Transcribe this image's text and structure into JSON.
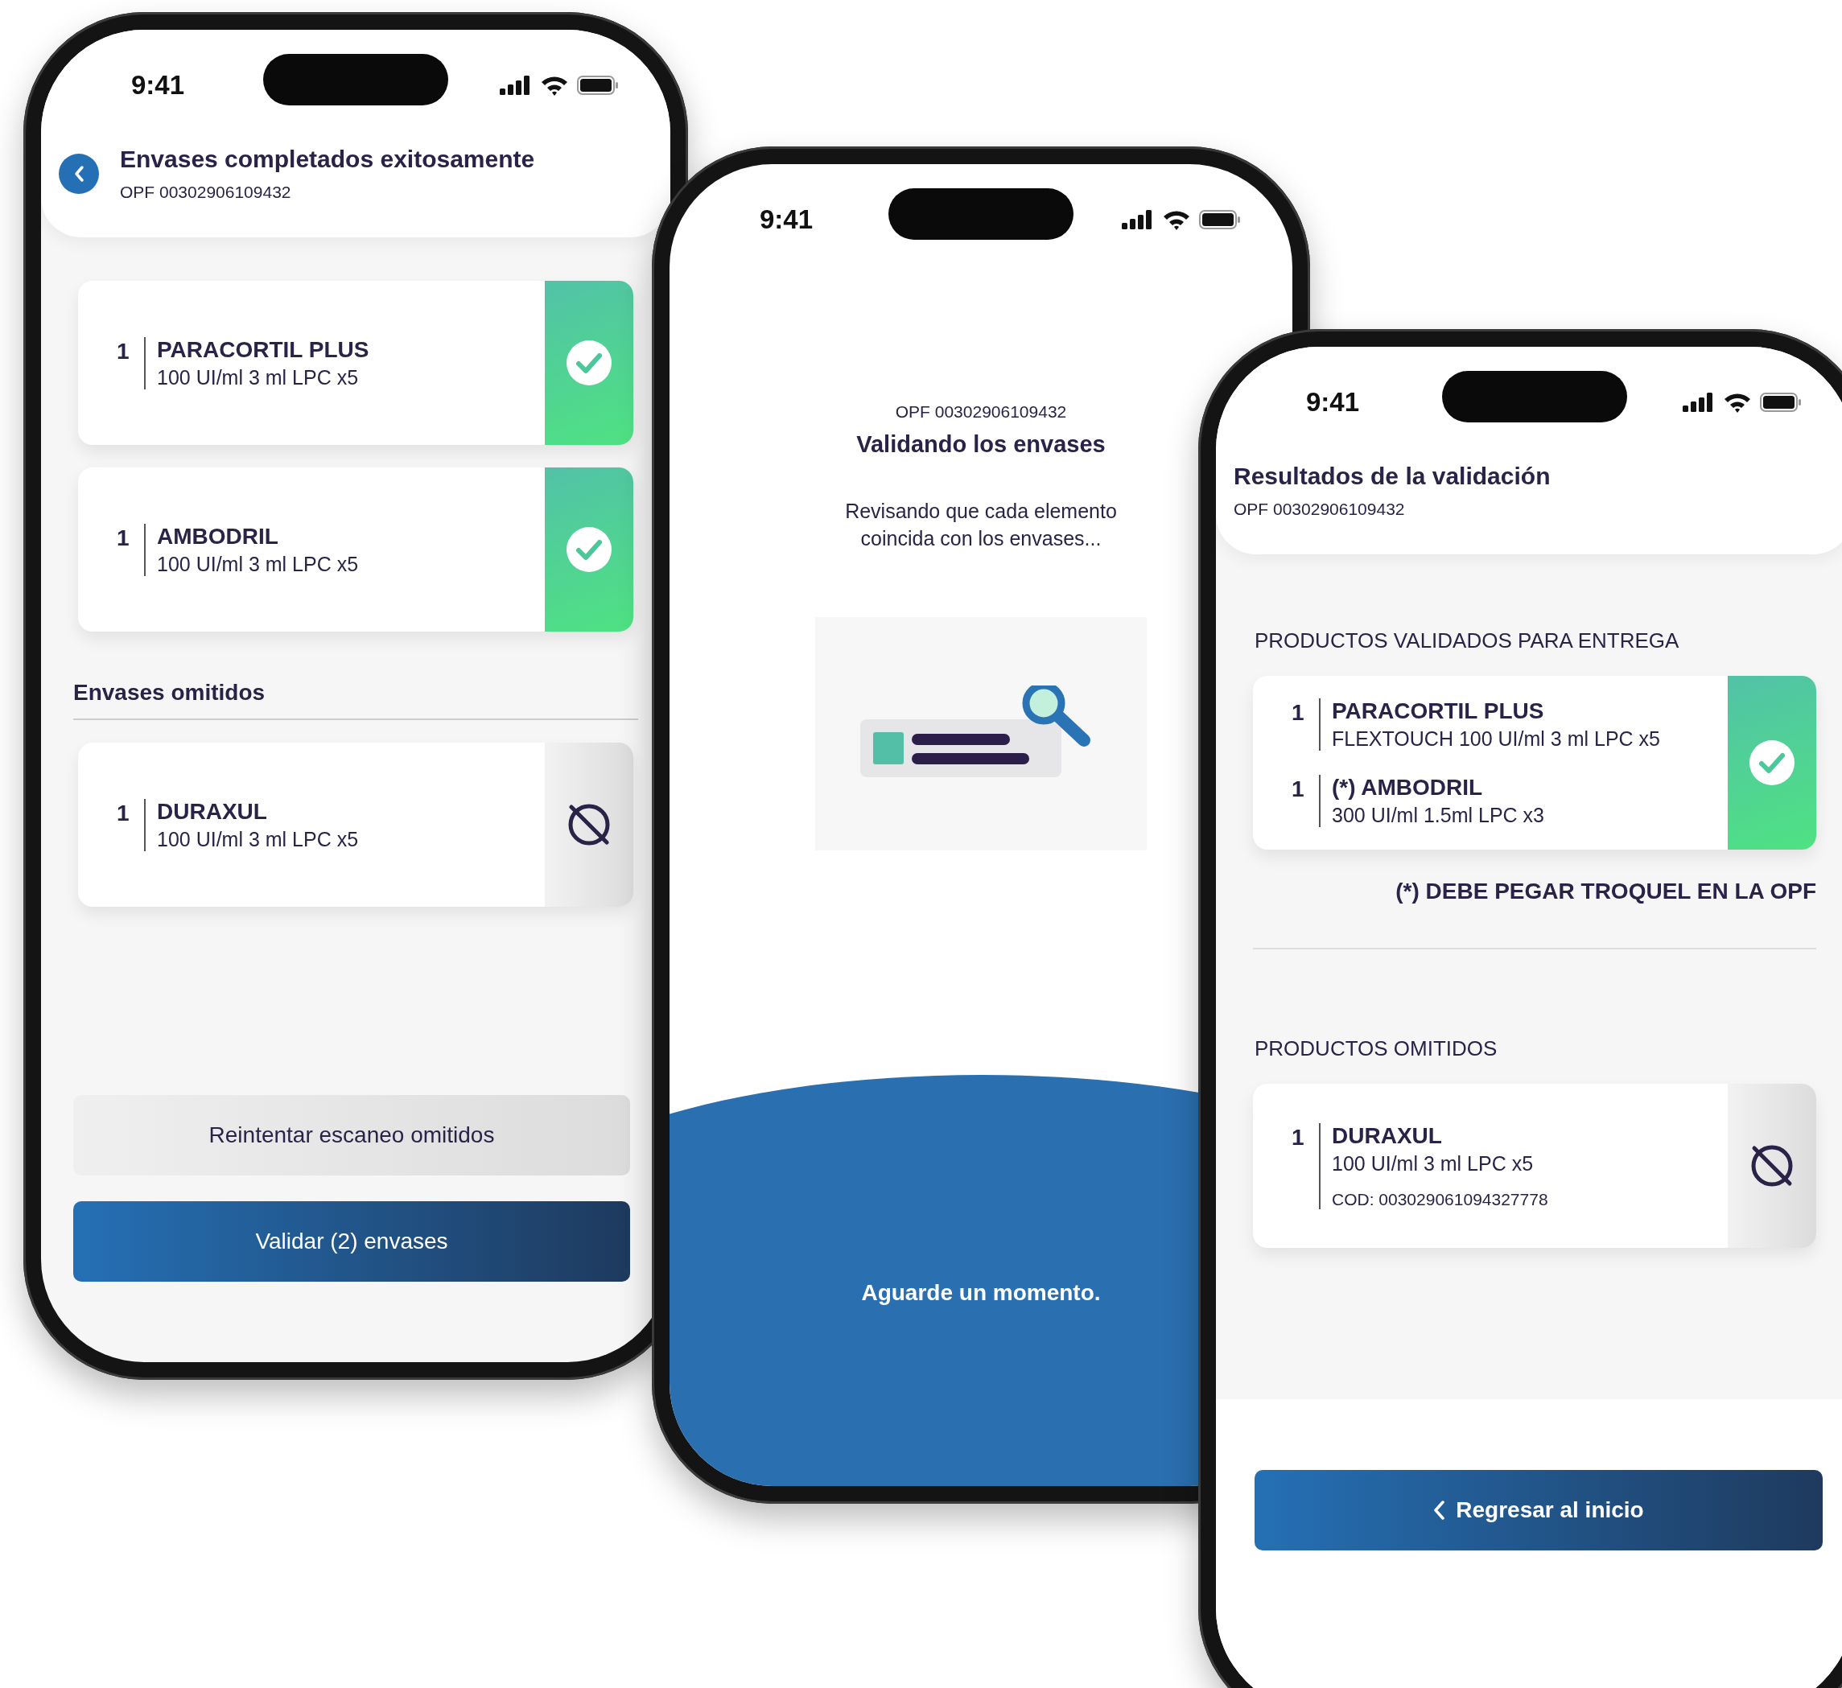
{
  "phones": [
    {
      "kind": "summary",
      "time": "9:41",
      "header": {
        "title": "Envases completados exitosamente",
        "subtitle": "OPF 00302906109432",
        "back": true
      },
      "sections": [
        {
          "kind": "plain",
          "cards": [
            {
              "kind": "validated",
              "items": [
                {
                  "qty": "1",
                  "name": "PARACORTIL PLUS",
                  "details": [
                    "100 UI/ml 3 ml LPC x5"
                  ]
                }
              ]
            },
            {
              "kind": "validated",
              "items": [
                {
                  "qty": "1",
                  "name": "AMBODRIL",
                  "details": [
                    "100 UI/ml 3 ml LPC x5"
                  ]
                }
              ]
            }
          ]
        },
        {
          "kind": "bold",
          "heading": "Envases omitidos",
          "cards": [
            {
              "kind": "omitted",
              "items": [
                {
                  "qty": "1",
                  "name": "DURAXUL",
                  "details": [
                    "100 UI/ml 3 ml LPC x5"
                  ]
                }
              ]
            }
          ]
        }
      ],
      "buttons": [
        {
          "label": "Reintentar escaneo omitidos",
          "kind": "secondary"
        },
        {
          "label": "Validar (2) envases",
          "kind": "primary"
        }
      ]
    },
    {
      "kind": "loading",
      "time": "9:41",
      "opf": "OPF 00302906109432",
      "title": "Validando los envases",
      "message": "Revisando que cada elemento coincida con los envases...",
      "wait": "Aguarde un momento."
    },
    {
      "kind": "results",
      "time": "9:41",
      "header": {
        "title": "Resultados de la validación",
        "subtitle": "OPF 00302906109432",
        "back": false
      },
      "sections": [
        {
          "kind": "caps",
          "heading": "PRODUCTOS VALIDADOS PARA ENTREGA",
          "cards": [
            {
              "kind": "validated",
              "items": [
                {
                  "qty": "1",
                  "name": "PARACORTIL PLUS",
                  "details": [
                    "FLEXTOUCH 100 UI/ml 3 ml LPC x5"
                  ]
                },
                {
                  "qty": "1",
                  "name": "(*) AMBODRIL",
                  "details": [
                    "300 UI/ml 1.5ml LPC x3"
                  ]
                }
              ]
            }
          ],
          "note": "(*) DEBE PEGAR TROQUEL EN LA OPF"
        },
        {
          "kind": "caps",
          "heading": "PRODUCTOS OMITIDOS",
          "cards": [
            {
              "kind": "omitted",
              "items": [
                {
                  "qty": "1",
                  "name": "DURAXUL",
                  "details": [
                    "100 UI/ml 3 ml LPC x5"
                  ],
                  "code": "COD: 003029061094327778"
                }
              ]
            }
          ]
        }
      ],
      "buttons": [
        {
          "label": "Regresar al inicio",
          "kind": "back"
        }
      ]
    }
  ]
}
